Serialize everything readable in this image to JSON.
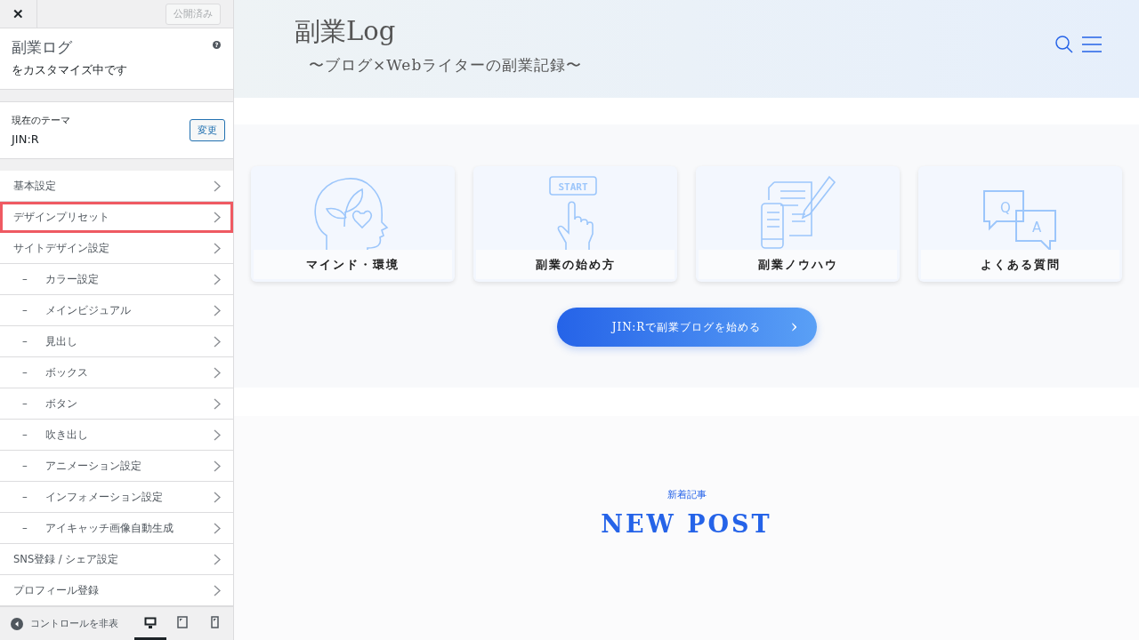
{
  "sidebar": {
    "close": "✕",
    "publish_button": {
      "label": "公開済み",
      "disabled": true
    },
    "site_title": "副業ログ",
    "customizing": "をカスタマイズ中です",
    "help": "?",
    "theme": {
      "caption": "現在のテーマ",
      "name": "JIN:R",
      "change_button": "変更"
    },
    "menu": [
      {
        "label": "基本設定",
        "kind": "top",
        "highlighted": false
      },
      {
        "label": "デザインプリセット",
        "kind": "top",
        "highlighted": true
      },
      {
        "label": "サイトデザイン設定",
        "kind": "top",
        "highlighted": false
      },
      {
        "label": "カラー設定",
        "kind": "sub",
        "prefix": "–",
        "highlighted": false
      },
      {
        "label": "メインビジュアル",
        "kind": "sub",
        "prefix": "–",
        "highlighted": false
      },
      {
        "label": "見出し",
        "kind": "sub",
        "prefix": "–",
        "highlighted": false
      },
      {
        "label": "ボックス",
        "kind": "sub",
        "prefix": "–",
        "highlighted": false
      },
      {
        "label": "ボタン",
        "kind": "sub",
        "prefix": "–",
        "highlighted": false
      },
      {
        "label": "吹き出し",
        "kind": "sub",
        "prefix": "–",
        "highlighted": false
      },
      {
        "label": "アニメーション設定",
        "kind": "sub",
        "prefix": "–",
        "highlighted": false
      },
      {
        "label": "インフォメーション設定",
        "kind": "sub",
        "prefix": "–",
        "highlighted": false
      },
      {
        "label": "アイキャッチ画像自動生成",
        "kind": "sub",
        "prefix": "–",
        "highlighted": false
      },
      {
        "label": "SNS登録 / シェア設定",
        "kind": "top",
        "highlighted": false
      },
      {
        "label": "プロフィール登録",
        "kind": "top",
        "highlighted": false
      }
    ],
    "footer": {
      "hide_controls": "コントロールを非表",
      "devices": [
        {
          "kind": "desktop",
          "selected": true
        },
        {
          "kind": "tablet",
          "selected": false
        },
        {
          "kind": "mobile",
          "selected": false
        }
      ]
    }
  },
  "preview": {
    "logo": "副業Log",
    "tagline": "〜ブログ×Webライターの副業記録〜",
    "cards": [
      {
        "label": "マインド・環境",
        "kind": "head"
      },
      {
        "label": "副業の始め方",
        "kind": "start",
        "icon_texts": [
          "START"
        ]
      },
      {
        "label": "副業ノウハウ",
        "kind": "docs"
      },
      {
        "label": "よくある質問",
        "kind": "qa",
        "icon_texts": [
          "Q",
          "A"
        ]
      }
    ],
    "cta_button": "JIN:Rで副業ブログを始める",
    "cta_arrow": "›",
    "section_kicker": "新着記事",
    "section_title": "NEW POST"
  }
}
